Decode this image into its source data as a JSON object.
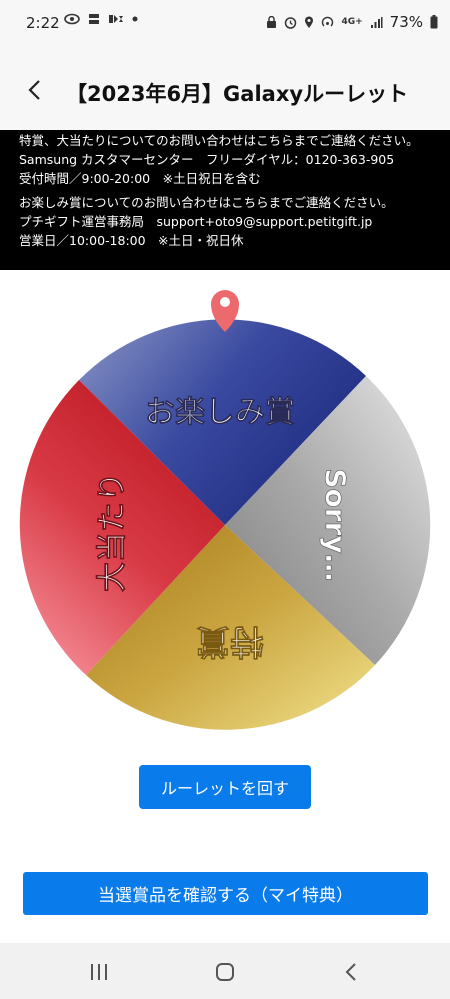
{
  "status_bar": {
    "time": "2:22",
    "battery": "73%",
    "network": "4G+"
  },
  "app_bar": {
    "title": "【2023年6月】Galaxyルーレット"
  },
  "info": {
    "lines1": [
      "特賞、大当たりについてのお問い合わせはこちらまでご連絡ください。",
      "Samsung カスタマーセンター　フリーダイヤル：0120-363-905",
      "受付時間／9:00-20:00　※土日祝日を含む"
    ],
    "lines2": [
      "お楽しみ賞についてのお問い合わせはこちらまでご連絡ください。",
      "プチギフト運営事務局　support+oto9@support.petitgift.jp",
      "営業日／10:00-18:00　※土日・祝日休"
    ]
  },
  "wheel": {
    "segments": [
      {
        "label": "お楽しみ賞",
        "color": "#2b3a8f"
      },
      {
        "label": "Sorry…",
        "color": "#9a9a9a"
      },
      {
        "label": "特賞",
        "color": "#c8a23a"
      },
      {
        "label": "大当たり",
        "color": "#d0222e"
      }
    ],
    "pointer_color": "#ec6a6e"
  },
  "buttons": {
    "spin": "ルーレットを回す",
    "confirm": "当選賞品を確認する（マイ特典）"
  },
  "colors": {
    "accent": "#0a7bea"
  }
}
